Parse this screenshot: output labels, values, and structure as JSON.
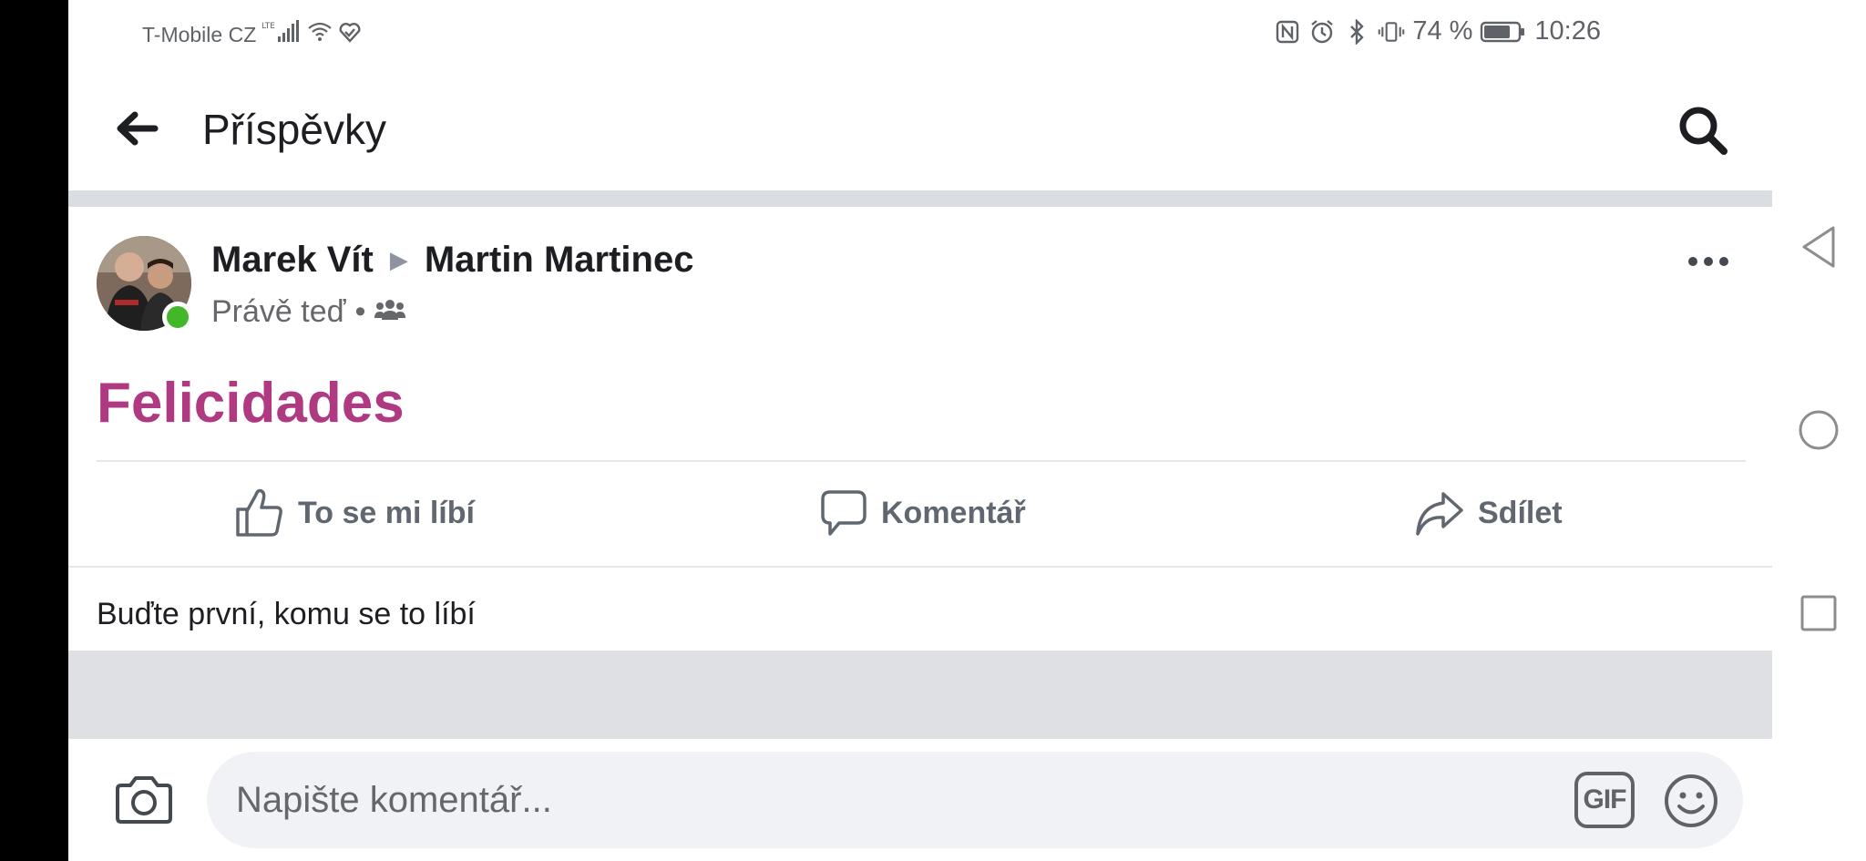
{
  "status_bar": {
    "carrier": "T-Mobile CZ",
    "network": "LTE",
    "battery": "74 %",
    "time": "10:26",
    "icons": [
      "signal-icon",
      "wifi-icon",
      "heart-check-icon",
      "nfc-icon",
      "alarm-icon",
      "bluetooth-icon",
      "vibrate-icon",
      "battery-icon"
    ]
  },
  "header": {
    "title": "Příspěvky"
  },
  "post": {
    "author": "Marek Vít",
    "target": "Martin Martinec",
    "time": "Právě teď",
    "audience_separator": "•",
    "text": "Felicidades",
    "text_color": "#b03a82",
    "actions": {
      "like": "To se mi líbí",
      "comment": "Komentář",
      "share": "Sdílet"
    },
    "likes_summary": "Buďte první, komu se to líbí"
  },
  "comment_bar": {
    "placeholder": "Napište komentář...",
    "gif_label": "GIF"
  },
  "colors": {
    "online": "#42b72a",
    "divider": "#dadde1",
    "action_text": "#606770"
  }
}
